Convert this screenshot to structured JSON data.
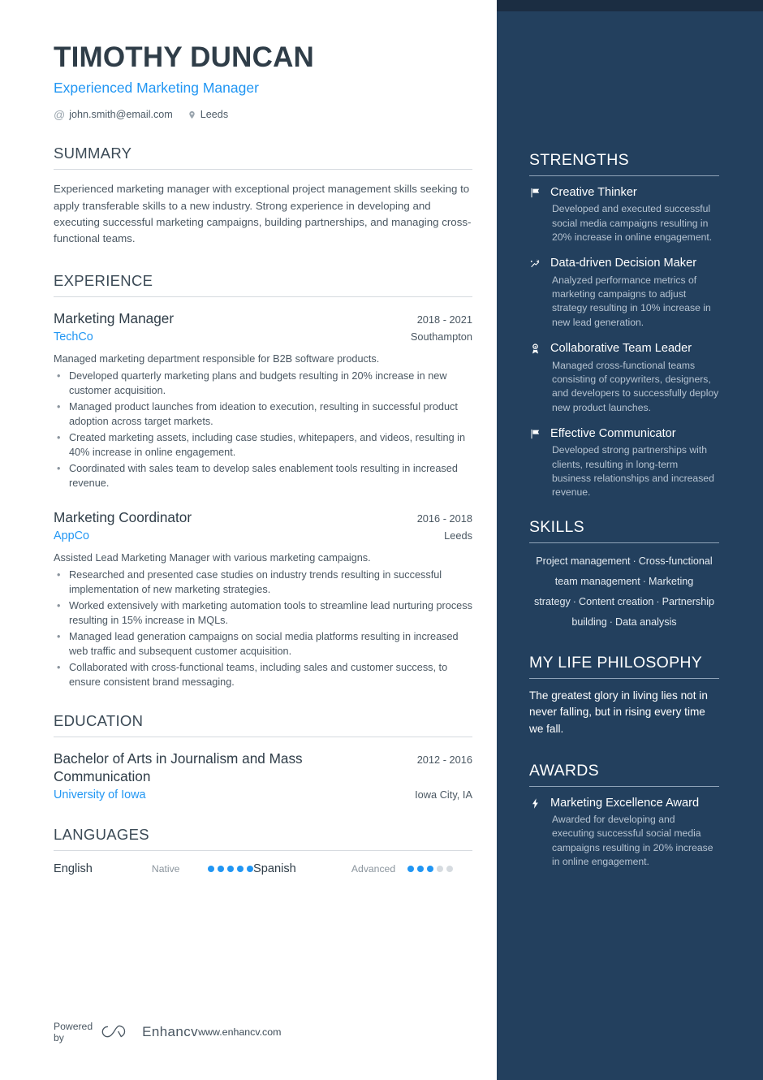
{
  "colors": {
    "sidebar_bg": "#23405e",
    "sidebar_top_strip": "#1b2d42",
    "accent_blue": "#2196f3",
    "heading_dark": "#2f3d48",
    "body_text": "#4a5762",
    "muted": "#8a949d",
    "dot_empty": "#d6dbe0"
  },
  "header": {
    "name": "TIMOTHY DUNCAN",
    "headline": "Experienced Marketing Manager",
    "contacts": [
      {
        "icon": "at-icon",
        "text": "john.smith@email.com"
      },
      {
        "icon": "location-pin-icon",
        "text": "Leeds"
      }
    ]
  },
  "summary": {
    "heading": "SUMMARY",
    "text": "Experienced marketing manager with exceptional project management skills seeking to apply transferable skills to a new industry. Strong experience in developing and executing successful marketing campaigns, building partnerships, and managing cross-functional teams."
  },
  "experience": {
    "heading": "EXPERIENCE",
    "entries": [
      {
        "title": "Marketing Manager",
        "date": "2018 - 2021",
        "organization": "TechCo",
        "location": "Southampton",
        "lead": "Managed marketing department responsible for B2B software products.",
        "bullets": [
          "Developed quarterly marketing plans and budgets resulting in 20% increase in new customer acquisition.",
          "Managed product launches from ideation to execution, resulting in successful product adoption across target markets.",
          "Created marketing assets, including case studies, whitepapers, and videos, resulting in 40% increase in online engagement.",
          "Coordinated with sales team to develop sales enablement tools resulting in increased revenue."
        ]
      },
      {
        "title": "Marketing Coordinator",
        "date": "2016 - 2018",
        "organization": "AppCo",
        "location": "Leeds",
        "lead": "Assisted Lead Marketing Manager with various marketing campaigns.",
        "bullets": [
          "Researched and presented case studies on industry trends resulting in successful implementation of new marketing strategies.",
          "Worked extensively with marketing automation tools to streamline lead nurturing process resulting in 15% increase in MQLs.",
          "Managed lead generation campaigns on social media platforms resulting in increased web traffic and subsequent customer acquisition.",
          "Collaborated with cross-functional teams, including sales and customer success, to ensure consistent brand messaging."
        ]
      }
    ]
  },
  "education": {
    "heading": "EDUCATION",
    "entries": [
      {
        "title": "Bachelor of Arts in Journalism and Mass Communication",
        "date": "2012 - 2016",
        "organization": "University of Iowa",
        "location": "Iowa City, IA"
      }
    ]
  },
  "languages": {
    "heading": "LANGUAGES",
    "items": [
      {
        "name": "English",
        "level": "Native",
        "filled": 5,
        "total": 5
      },
      {
        "name": "Spanish",
        "level": "Advanced",
        "filled": 3,
        "total": 5
      }
    ]
  },
  "strengths": {
    "heading": "STRENGTHS",
    "items": [
      {
        "icon": "flag-icon",
        "title": "Creative Thinker",
        "description": "Developed and executed successful social media campaigns resulting in 20% increase in online engagement."
      },
      {
        "icon": "trending-up-icon",
        "title": "Data-driven Decision Maker",
        "description": "Analyzed performance metrics of marketing campaigns to adjust strategy resulting in 10% increase in new lead generation."
      },
      {
        "icon": "award-medal-icon",
        "title": "Collaborative Team Leader",
        "description": "Managed cross-functional teams consisting of copywriters, designers, and developers to successfully deploy new product launches."
      },
      {
        "icon": "flag-icon",
        "title": "Effective Communicator",
        "description": "Developed strong partnerships with clients, resulting in long-term business relationships and increased revenue."
      }
    ]
  },
  "skills": {
    "heading": "SKILLS",
    "separator": "·",
    "items": [
      "Project management",
      "Cross-functional team management",
      "Marketing strategy",
      "Content creation",
      "Partnership building",
      "Data analysis"
    ]
  },
  "philosophy": {
    "heading": "MY LIFE PHILOSOPHY",
    "quote": "The greatest glory in living lies not in never falling, but in rising every time we fall."
  },
  "awards": {
    "heading": "AWARDS",
    "items": [
      {
        "icon": "lightning-bolt-icon",
        "title": "Marketing Excellence Award",
        "description": "Awarded for developing and executing successful social media campaigns resulting in 20% increase in online engagement."
      }
    ]
  },
  "footer": {
    "powered_by": "Powered by",
    "brand": "Enhancv",
    "url": "www.enhancv.com"
  }
}
